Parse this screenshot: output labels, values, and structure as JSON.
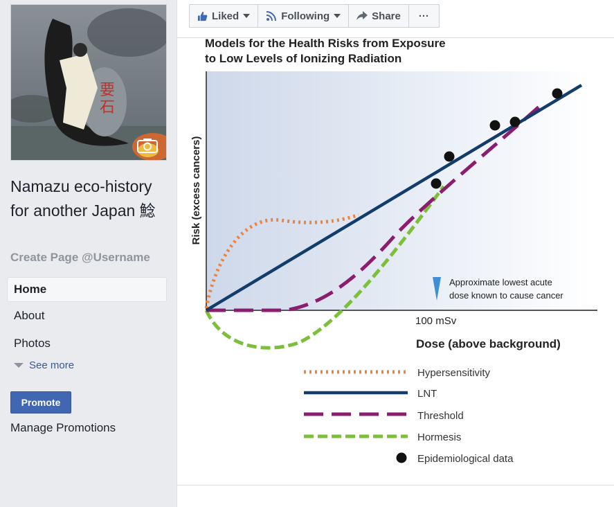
{
  "page": {
    "name": "Namazu eco-history for another Japan 鯰",
    "username_link": "Create Page @Username"
  },
  "sidebar": {
    "nav": [
      {
        "label": "Home",
        "active": true
      },
      {
        "label": "About",
        "active": false
      },
      {
        "label": "Photos",
        "active": false
      }
    ],
    "see_more": "See more",
    "promote": "Promote",
    "manage_promotions": "Manage Promotions"
  },
  "action_bar": {
    "liked": "Liked",
    "following": "Following",
    "share": "Share",
    "more": "···"
  },
  "colors": {
    "fb_blue": "#4267b2",
    "hypersensitivity": "#f0823c",
    "lnt": "#123d6b",
    "threshold": "#8b1d6e",
    "hormesis": "#7cbf3a"
  },
  "chart_data": {
    "type": "line",
    "title": "Models for the Health Risks from Exposure to Low Levels of Ionizing Radiation",
    "xlabel": "Dose (above background)",
    "ylabel": "Risk (excess cancers)",
    "x_tick": "100 mSv",
    "annotation": "Approximate lowest acute dose known to cause cancer",
    "series": [
      {
        "name": "Hypersensitivity",
        "style": "dotted",
        "color": "#f0823c"
      },
      {
        "name": "LNT",
        "style": "solid",
        "color": "#123d6b"
      },
      {
        "name": "Threshold",
        "style": "dashed",
        "color": "#8b1d6e"
      },
      {
        "name": "Hormesis",
        "style": "dashed",
        "color": "#7cbf3a"
      },
      {
        "name": "Epidemiological data",
        "style": "points",
        "color": "#000000"
      }
    ]
  }
}
